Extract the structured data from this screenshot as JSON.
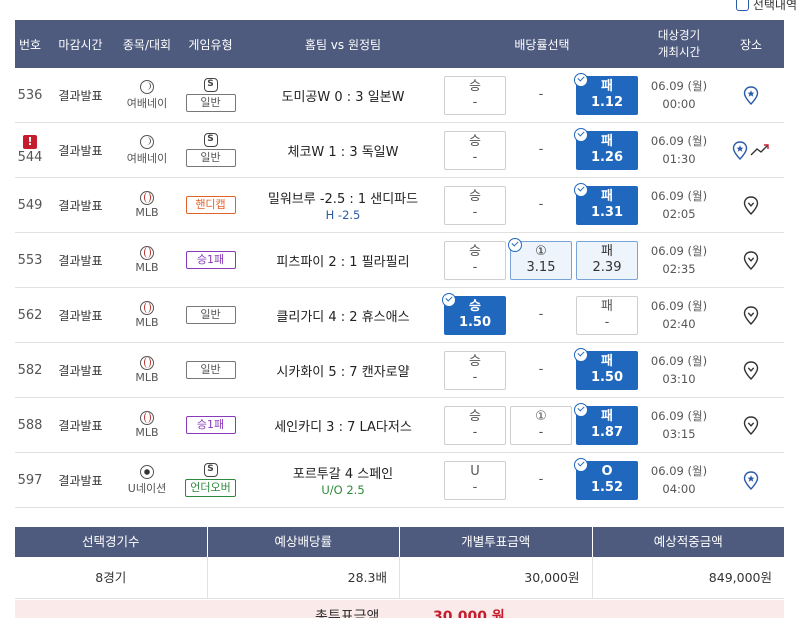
{
  "top": {
    "selection_label": "선택내역"
  },
  "header": {
    "no": "번호",
    "deadline": "마감시간",
    "sport": "종목/대회",
    "type": "게임유형",
    "match": "홈팀 vs 원정팀",
    "odds": "배당률선택",
    "date_line1": "대상경기",
    "date_line2": "개최시간",
    "place": "장소"
  },
  "rows": [
    {
      "no": "536",
      "warn": "",
      "status": "결과발표",
      "sport": "여배네이",
      "sport_icon": "volleyball-icon",
      "s_badge": "S",
      "type": "일반",
      "match": "도미공W 0 : 3 일본W",
      "sub": "",
      "odds": [
        {
          "lbl": "승",
          "val": "-"
        },
        {
          "lbl": "-",
          "val": ""
        },
        {
          "lbl": "패",
          "val": "1.12"
        }
      ],
      "date": "06.09 (월)",
      "time": "00:00"
    },
    {
      "no": "544",
      "warn": "!",
      "status": "결과발표",
      "sport": "여배네이",
      "sport_icon": "volleyball-icon",
      "s_badge": "S",
      "type": "일반",
      "match": "체코W 1 : 3 독일W",
      "sub": "",
      "odds": [
        {
          "lbl": "승",
          "val": "-"
        },
        {
          "lbl": "-",
          "val": ""
        },
        {
          "lbl": "패",
          "val": "1.26"
        }
      ],
      "date": "06.09 (월)",
      "time": "01:30"
    },
    {
      "no": "549",
      "warn": "",
      "status": "결과발표",
      "sport": "MLB",
      "sport_icon": "baseball-icon",
      "s_badge": "",
      "type": "핸디캡",
      "match": "밀워브루 -2.5 : 1 샌디파드",
      "sub": "H -2.5",
      "odds": [
        {
          "lbl": "승",
          "val": "-"
        },
        {
          "lbl": "-",
          "val": ""
        },
        {
          "lbl": "패",
          "val": "1.31"
        }
      ],
      "date": "06.09 (월)",
      "time": "02:05"
    },
    {
      "no": "553",
      "warn": "",
      "status": "결과발표",
      "sport": "MLB",
      "sport_icon": "baseball-icon",
      "s_badge": "",
      "type": "승1패",
      "match": "피츠파이 2 : 1 필라필리",
      "sub": "",
      "odds": [
        {
          "lbl": "승",
          "val": "-"
        },
        {
          "lbl": "①",
          "val": "3.15"
        },
        {
          "lbl": "패",
          "val": "2.39"
        }
      ],
      "date": "06.09 (월)",
      "time": "02:35"
    },
    {
      "no": "562",
      "warn": "",
      "status": "결과발표",
      "sport": "MLB",
      "sport_icon": "baseball-icon",
      "s_badge": "",
      "type": "일반",
      "match": "클리가디 4 : 2 휴스애스",
      "sub": "",
      "odds": [
        {
          "lbl": "승",
          "val": "1.50"
        },
        {
          "lbl": "-",
          "val": ""
        },
        {
          "lbl": "패",
          "val": "-"
        }
      ],
      "date": "06.09 (월)",
      "time": "02:40"
    },
    {
      "no": "582",
      "warn": "",
      "status": "결과발표",
      "sport": "MLB",
      "sport_icon": "baseball-icon",
      "s_badge": "",
      "type": "일반",
      "match": "시카화이 5 : 7 캔자로얄",
      "sub": "",
      "odds": [
        {
          "lbl": "승",
          "val": "-"
        },
        {
          "lbl": "-",
          "val": ""
        },
        {
          "lbl": "패",
          "val": "1.50"
        }
      ],
      "date": "06.09 (월)",
      "time": "03:10"
    },
    {
      "no": "588",
      "warn": "",
      "status": "결과발표",
      "sport": "MLB",
      "sport_icon": "baseball-icon",
      "s_badge": "",
      "type": "승1패",
      "match": "세인카디 3 : 7 LA다저스",
      "sub": "",
      "odds": [
        {
          "lbl": "승",
          "val": "-"
        },
        {
          "lbl": "①",
          "val": "-"
        },
        {
          "lbl": "패",
          "val": "1.87"
        }
      ],
      "date": "06.09 (월)",
      "time": "03:15"
    },
    {
      "no": "597",
      "warn": "",
      "status": "결과발표",
      "sport": "U네이션",
      "sport_icon": "soccer-ball-icon",
      "s_badge": "S",
      "type": "언더오버",
      "match": "포르투갈    4     스페인",
      "sub": "U/O 2.5",
      "odds": [
        {
          "lbl": "U",
          "val": "-"
        },
        {
          "lbl": "-",
          "val": ""
        },
        {
          "lbl": "O",
          "val": "1.52"
        }
      ],
      "date": "06.09 (월)",
      "time": "04:00"
    }
  ],
  "summary": {
    "h1": "선택경기수",
    "h2": "예상배당률",
    "h3": "개별투표금액",
    "h4": "예상적중금액",
    "v1": "8경기",
    "v2": "28.3배",
    "v3": "30,000원",
    "v4": "849,000원"
  },
  "bottom": {
    "label": "총투표금액",
    "value": "30,000 원"
  },
  "colors": {
    "header_bg": "#4e5b7e",
    "selected_odd": "#2068be",
    "warn": "#c41d2e"
  }
}
